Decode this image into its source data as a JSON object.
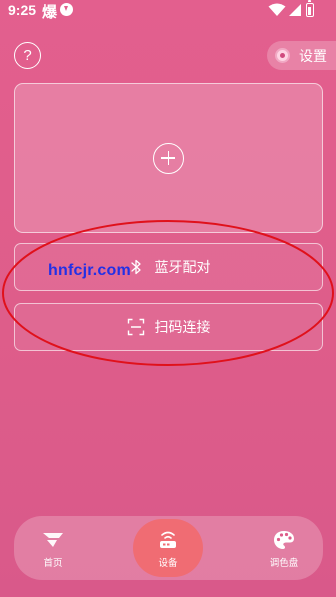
{
  "status_bar": {
    "time": "9:25",
    "app_glyph": "爆",
    "icons": [
      "download-icon",
      "wifi-icon",
      "signal-icon",
      "battery-icon"
    ]
  },
  "header": {
    "help_label": "?",
    "settings_label": "设置"
  },
  "add_card": {
    "icon": "plus-circle-icon"
  },
  "options": {
    "bluetooth_label": "蓝牙配对",
    "bluetooth_icon": "bluetooth-icon",
    "scan_label": "扫码连接",
    "scan_icon": "scan-icon"
  },
  "watermark": "hnfcjr.com",
  "bottom_nav": {
    "items": [
      {
        "label": "首页",
        "icon": "home-logo-icon",
        "active": false
      },
      {
        "label": "设备",
        "icon": "router-icon",
        "active": true
      },
      {
        "label": "调色盘",
        "icon": "palette-icon",
        "active": false
      }
    ]
  },
  "colors": {
    "background": "#e35f8e",
    "active_nav": "#f06c73",
    "annotation_ellipse": "#e0111b",
    "watermark": "#2230e6"
  }
}
